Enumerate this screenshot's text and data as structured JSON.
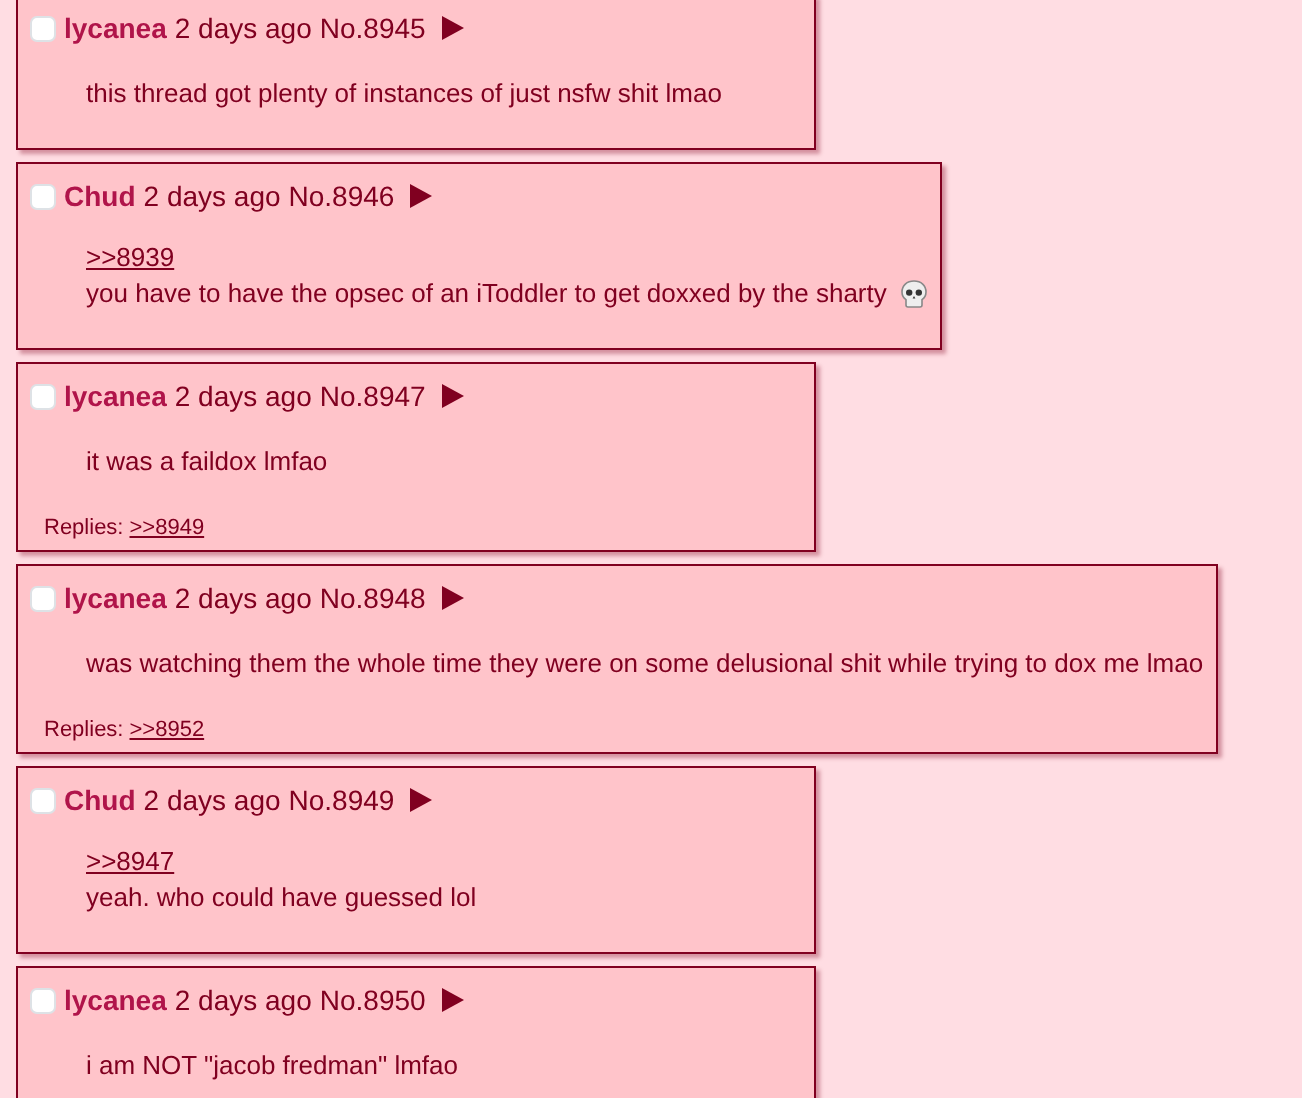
{
  "posts": [
    {
      "checked": false,
      "name": "lycanea",
      "time": "2 days ago",
      "number": "No.8945",
      "body": "this thread got plenty of instances of just nsfw shit lmao"
    },
    {
      "checked": false,
      "name": "Chud",
      "time": "2 days ago",
      "number": "No.8946",
      "quotes": [
        ">>8939"
      ],
      "body": "you have to have the opsec of an iToddler to get doxxed by the sharty",
      "emoji": true
    },
    {
      "checked": false,
      "name": "lycanea",
      "time": "2 days ago",
      "number": "No.8947",
      "body": "it was a faildox lmfao",
      "replies_label": "Replies:",
      "replies": [
        ">>8949"
      ]
    },
    {
      "checked": false,
      "name": "lycanea",
      "time": "2 days ago",
      "number": "No.8948",
      "body": "was watching them the whole time they were on some delusional shit while trying to dox me lmao",
      "replies_label": "Replies:",
      "replies": [
        ">>8952"
      ]
    },
    {
      "checked": false,
      "name": "Chud",
      "time": "2 days ago",
      "number": "No.8949",
      "quotes": [
        ">>8947"
      ],
      "body": "yeah. who could have guessed lol"
    },
    {
      "checked": false,
      "name": "lycanea",
      "time": "2 days ago",
      "number": "No.8950",
      "body": "i am NOT \"jacob fredman\" lmfao"
    }
  ]
}
